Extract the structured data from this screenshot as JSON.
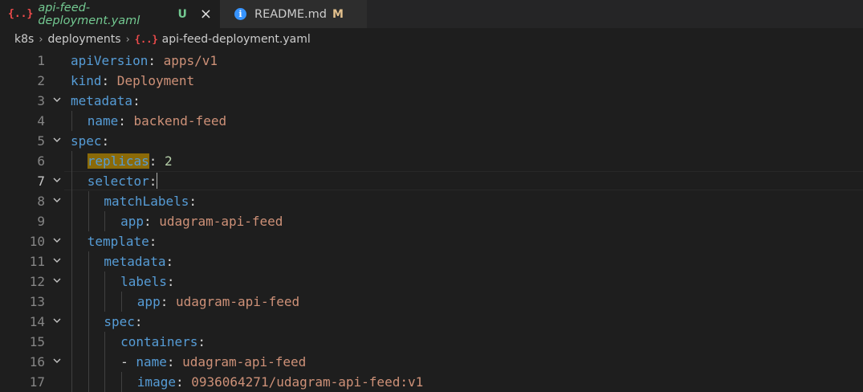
{
  "tabs": [
    {
      "icon_text": "{..}",
      "name": "api-feed-deployment.yaml",
      "status": "U",
      "close": "×",
      "icon": "yaml-braces-icon",
      "status_color": "#73c991"
    },
    {
      "icon_text": "i",
      "name": "README.md",
      "status": "M",
      "icon": "info-icon",
      "status_color": "#e2c08d"
    }
  ],
  "breadcrumb": {
    "items": [
      "k8s",
      "deployments",
      "api-feed-deployment.yaml"
    ],
    "file_icon_text": "{..}",
    "separator": "›"
  },
  "editor": {
    "current_line": 7,
    "lines": [
      {
        "n": "1",
        "indent": 0,
        "fold": false,
        "key": "apiVersion",
        "colon": ":",
        "val": " apps/v1"
      },
      {
        "n": "2",
        "indent": 0,
        "fold": false,
        "key": "kind",
        "colon": ":",
        "val": " Deployment"
      },
      {
        "n": "3",
        "indent": 0,
        "fold": true,
        "key": "metadata",
        "colon": ":",
        "val": ""
      },
      {
        "n": "4",
        "indent": 1,
        "fold": false,
        "key": "name",
        "colon": ":",
        "val": " backend-feed"
      },
      {
        "n": "5",
        "indent": 0,
        "fold": true,
        "key": "spec",
        "colon": ":",
        "val": ""
      },
      {
        "n": "6",
        "indent": 1,
        "fold": false,
        "key": "replicas",
        "colon": ":",
        "num": " 2"
      },
      {
        "n": "7",
        "indent": 1,
        "fold": true,
        "key": "selector",
        "colon": ":",
        "val": ""
      },
      {
        "n": "8",
        "indent": 2,
        "fold": true,
        "key": "matchLabels",
        "colon": ":",
        "val": ""
      },
      {
        "n": "9",
        "indent": 3,
        "fold": false,
        "key": "app",
        "colon": ":",
        "val": " udagram-api-feed"
      },
      {
        "n": "10",
        "indent": 1,
        "fold": true,
        "key": "template",
        "colon": ":",
        "val": ""
      },
      {
        "n": "11",
        "indent": 2,
        "fold": true,
        "key": "metadata",
        "colon": ":",
        "val": ""
      },
      {
        "n": "12",
        "indent": 3,
        "fold": true,
        "key": "labels",
        "colon": ":",
        "val": ""
      },
      {
        "n": "13",
        "indent": 4,
        "fold": false,
        "key": "app",
        "colon": ":",
        "val": " udagram-api-feed"
      },
      {
        "n": "14",
        "indent": 2,
        "fold": true,
        "key": "spec",
        "colon": ":",
        "val": ""
      },
      {
        "n": "15",
        "indent": 3,
        "fold": false,
        "key": "containers",
        "colon": ":",
        "val": ""
      },
      {
        "n": "16",
        "indent": 3,
        "fold": true,
        "dash": "- ",
        "key": "name",
        "colon": ":",
        "val": " udagram-api-feed"
      },
      {
        "n": "17",
        "indent": 4,
        "fold": false,
        "key": "image",
        "colon": ":",
        "val": " 0936064271/udagram-api-feed:v1"
      }
    ]
  },
  "colors": {
    "key": "#569cd6",
    "string": "#ce9178",
    "number": "#b5cea8",
    "highlight": "#8b6a08"
  }
}
